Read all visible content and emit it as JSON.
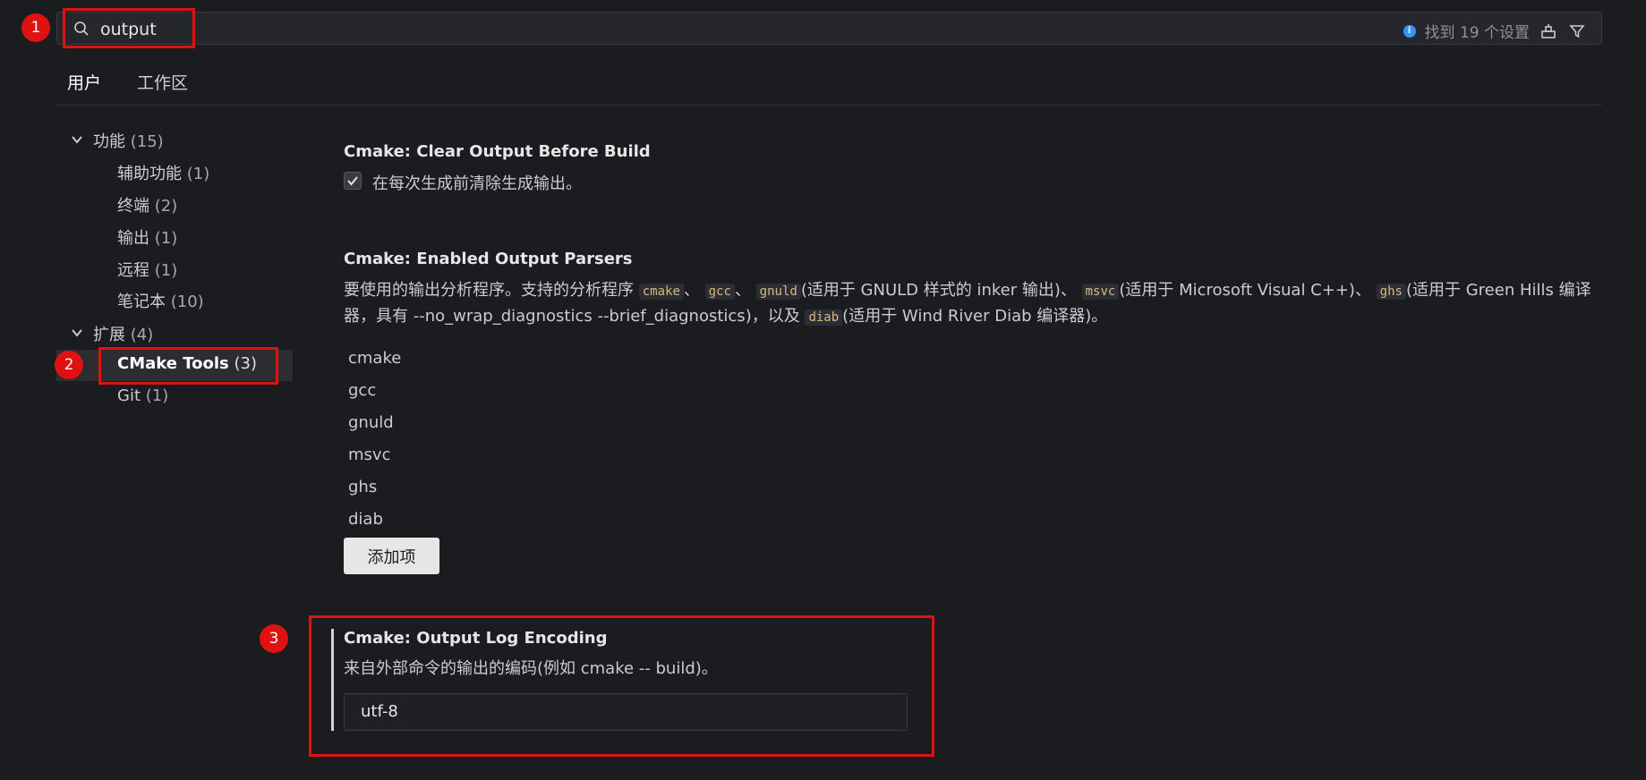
{
  "search": {
    "value": "output",
    "result_text": "找到 19 个设置"
  },
  "tabs": [
    {
      "label": "用户"
    },
    {
      "label": "工作区"
    }
  ],
  "tree": {
    "groups": [
      {
        "label": "功能",
        "count": "(15)",
        "children": [
          {
            "label": "辅助功能",
            "count": "(1)"
          },
          {
            "label": "终端",
            "count": "(2)"
          },
          {
            "label": "输出",
            "count": "(1)"
          },
          {
            "label": "远程",
            "count": "(1)"
          },
          {
            "label": "笔记本",
            "count": "(10)"
          }
        ]
      },
      {
        "label": "扩展",
        "count": "(4)",
        "children": [
          {
            "label": "CMake Tools",
            "count": "(3)"
          },
          {
            "label": "Git",
            "count": "(1)"
          }
        ]
      }
    ]
  },
  "settings": {
    "clear_output": {
      "category": "Cmake: ",
      "name": "Clear Output Before Build",
      "checkbox_label": "在每次生成前清除生成输出。",
      "checked": true
    },
    "parsers": {
      "category": "Cmake: ",
      "name": "Enabled Output Parsers",
      "desc_1": "要使用的输出分析程序。支持的分析程序",
      "code_cmake": "cmake",
      "sep": "、",
      "code_gcc": "gcc",
      "code_gnuld": "gnuld",
      "desc_gnuld": "(适用于 GNULD 样式的 inker 输出)",
      "code_msvc": "msvc",
      "desc_msvc": "(适用于 Microsoft Visual C++)",
      "code_ghs": "ghs",
      "desc_ghs": "(适用于 Green Hills 编译器，具有 --no_wrap_diagnostics --brief_diagnostics)，以及",
      "code_diab": "diab",
      "desc_diab": "(适用于 Wind River Diab 编译器)。",
      "items": [
        "cmake",
        "gcc",
        "gnuld",
        "msvc",
        "ghs",
        "diab"
      ],
      "add_label": "添加项"
    },
    "log_encoding": {
      "category": "Cmake: ",
      "name": "Output Log Encoding",
      "desc": "来自外部命令的输出的编码(例如 cmake -- build)。",
      "value": "utf-8"
    }
  },
  "callouts": [
    "1",
    "2",
    "3"
  ],
  "colors": {
    "background": "#1b1c20",
    "callout": "#e01111",
    "info": "#3794ff"
  },
  "icons": [
    "search-icon",
    "info-icon",
    "clear-filter-icon",
    "filter-icon",
    "chevron-down-icon",
    "check-icon"
  ]
}
